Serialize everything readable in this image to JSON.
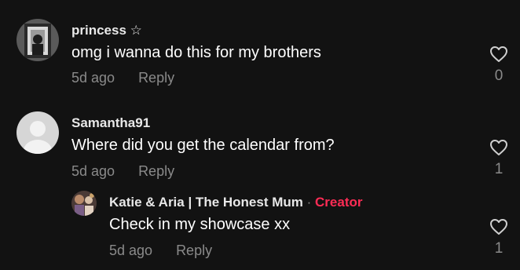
{
  "comments": [
    {
      "username": "princess ☆",
      "text": "omg i wanna do this for my brothers",
      "time": "5d ago",
      "reply_label": "Reply",
      "likes": "0"
    },
    {
      "username": "Samantha91",
      "text": "Where did you get the calendar from?",
      "time": "5d ago",
      "reply_label": "Reply",
      "likes": "1"
    }
  ],
  "reply": {
    "username": "Katie & Aria | The Honest Mum",
    "separator": "·",
    "badge": "Creator",
    "text": "Check in my showcase xx",
    "time": "5d ago",
    "reply_label": "Reply",
    "likes": "1"
  },
  "colors": {
    "background": "#121212",
    "creator": "#fe2c55",
    "muted": "#8a8a8a"
  }
}
